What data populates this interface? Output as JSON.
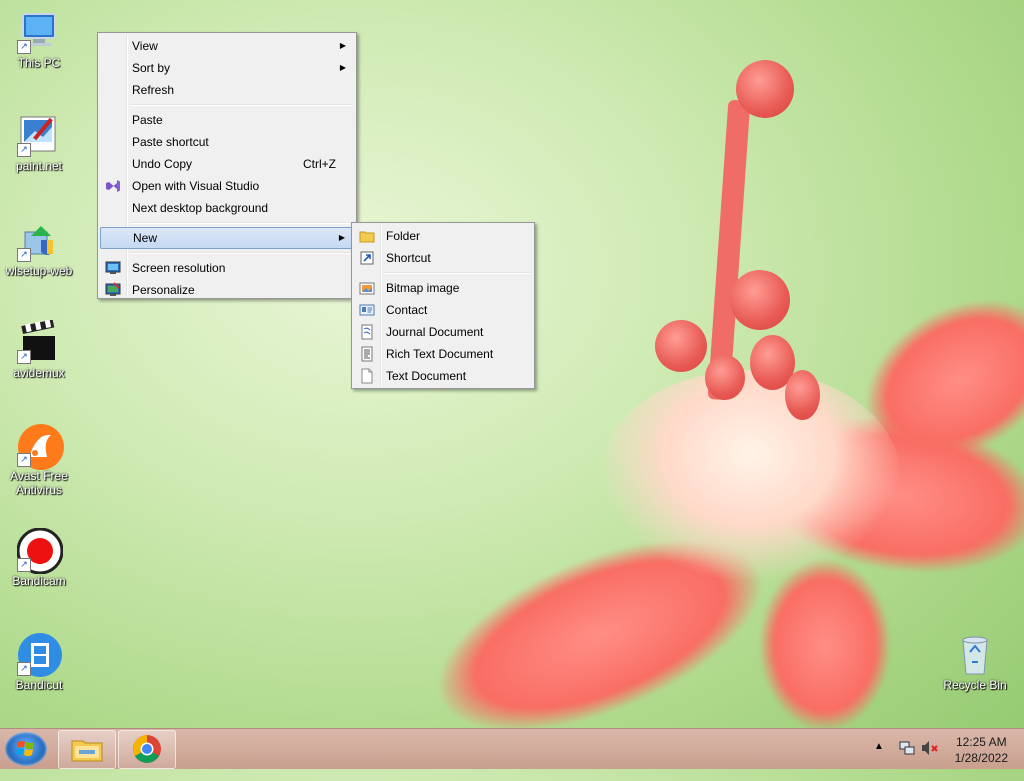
{
  "desktop": {
    "icons": [
      {
        "label": "This PC"
      },
      {
        "label": "paint.net"
      },
      {
        "label": "wlsetup-web"
      },
      {
        "label": "avidemux"
      },
      {
        "label_line1": "Avast Free",
        "label_line2": "Antivirus"
      },
      {
        "label": "Bandicam"
      },
      {
        "label": "Bandicut"
      },
      {
        "label": "Recycle Bin"
      }
    ]
  },
  "context_menu": {
    "items": [
      {
        "label": "View"
      },
      {
        "label": "Sort by"
      },
      {
        "label": "Refresh"
      },
      {
        "label": "Paste"
      },
      {
        "label": "Paste shortcut"
      },
      {
        "label": "Undo Copy",
        "shortcut": "Ctrl+Z"
      },
      {
        "label": "Open with Visual Studio"
      },
      {
        "label": "Next desktop background"
      },
      {
        "label": "New"
      },
      {
        "label": "Screen resolution"
      },
      {
        "label": "Personalize"
      }
    ]
  },
  "new_submenu": {
    "items": [
      {
        "label": "Folder"
      },
      {
        "label": "Shortcut"
      },
      {
        "label": "Bitmap image"
      },
      {
        "label": "Contact"
      },
      {
        "label": "Journal Document"
      },
      {
        "label": "Rich Text Document"
      },
      {
        "label": "Text Document"
      }
    ]
  },
  "taskbar": {
    "clock_time": "12:25 AM",
    "clock_date": "1/28/2022"
  },
  "colors": {
    "menu_highlight": "#c4d9f2",
    "taskbar": "#d1aa9a",
    "wallpaper": "#b8de96"
  },
  "icons": {
    "submenu_arrow": "triangle-right-icon",
    "tray_up": "chevron-up-icon",
    "network": "network-icon",
    "volume_muted": "volume-muted-icon"
  }
}
